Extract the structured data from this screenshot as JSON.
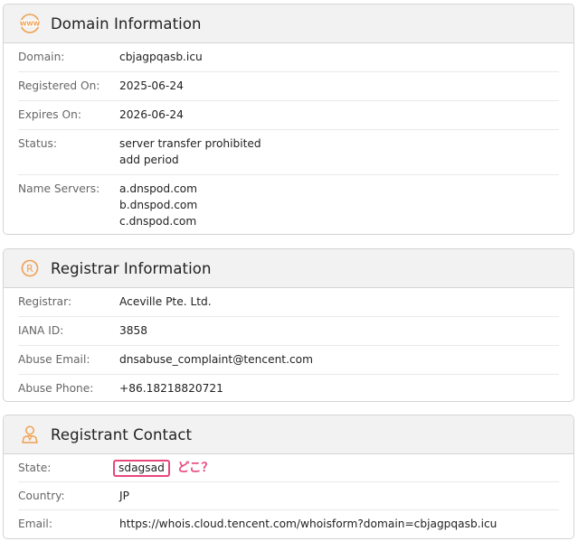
{
  "domain_info": {
    "title": "Domain Information",
    "icon": "www-globe-icon",
    "rows": [
      {
        "label": "Domain:",
        "values": [
          "cbjagpqasb.icu"
        ]
      },
      {
        "label": "Registered On:",
        "values": [
          "2025-06-24"
        ]
      },
      {
        "label": "Expires On:",
        "values": [
          "2026-06-24"
        ]
      },
      {
        "label": "Status:",
        "values": [
          "server transfer prohibited",
          "add period"
        ]
      },
      {
        "label": "Name Servers:",
        "values": [
          "a.dnspod.com",
          "b.dnspod.com",
          "c.dnspod.com"
        ]
      }
    ]
  },
  "registrar_info": {
    "title": "Registrar Information",
    "icon": "registered-trademark-icon",
    "rows": [
      {
        "label": "Registrar:",
        "values": [
          "Aceville Pte. Ltd."
        ]
      },
      {
        "label": "IANA ID:",
        "values": [
          "3858"
        ]
      },
      {
        "label": "Abuse Email:",
        "values": [
          "dnsabuse_complaint@tencent.com"
        ]
      },
      {
        "label": "Abuse Phone:",
        "values": [
          "+86.18218820721"
        ]
      }
    ]
  },
  "registrant_contact": {
    "title": "Registrant Contact",
    "icon": "person-icon",
    "state_label": "State:",
    "state_value": "sdagsad",
    "state_note": "どこ？",
    "rows": [
      {
        "label": "Country:",
        "values": [
          "JP"
        ]
      },
      {
        "label": "Email:",
        "values": [
          "https://whois.cloud.tencent.com/whoisform?domain=cbjagpqasb.icu"
        ]
      }
    ]
  },
  "colors": {
    "accent_orange": "#f0a050",
    "highlight_pink": "#e8477a"
  }
}
